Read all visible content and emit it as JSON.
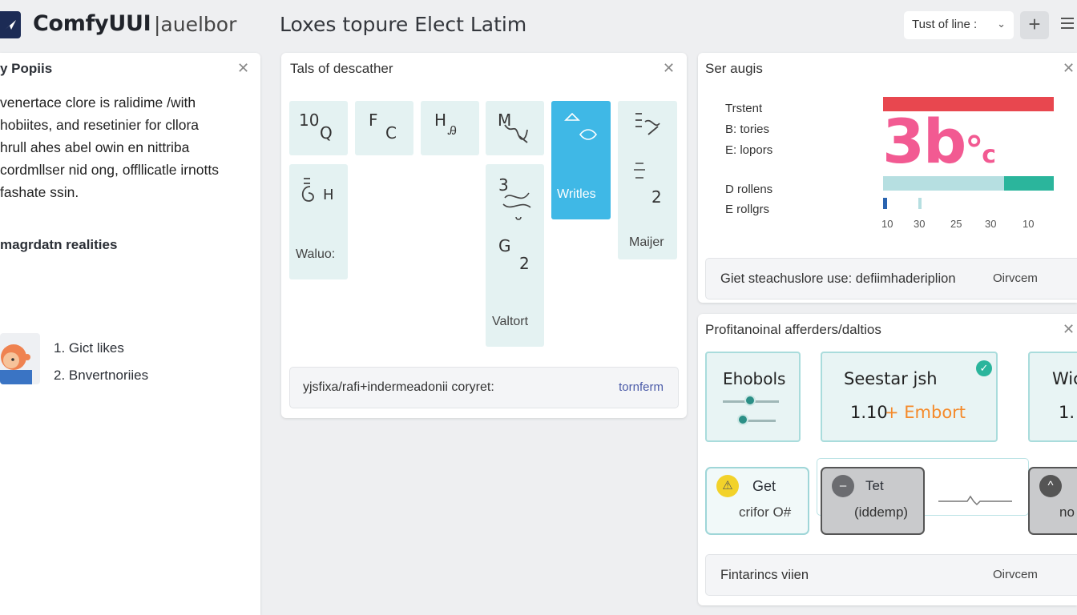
{
  "header": {
    "app_name": "ComfyUUI",
    "app_suffix": "|auelbor",
    "document_title": "Loxes topure Elect Latim",
    "dropdown_value": "Tust of line :",
    "add_symbol": "+"
  },
  "left_panel": {
    "title": "y Popiis",
    "paragraph": "venertace clore is ralidime /with\nhobiites, and resetinier for cllora\nhrull ahes abel owin en nittriba\ncordmllser nid ong, offllicatle irnotts\n fashate ssin.",
    "subheading": "magrdatn realities",
    "list": [
      "1. Gict likes",
      "2. Bnvertnoriies"
    ]
  },
  "middle_panel": {
    "title": "Tals of descather",
    "tiles": {
      "t1": "10",
      "t1b": "Q",
      "t2": "F",
      "t2b": "C",
      "t3": "H",
      "t3b": "Ꭿ",
      "t4": "M",
      "t7": "H",
      "t7_label": "Waluo:",
      "t8a": "3",
      "t8b": "G",
      "t8c": "2",
      "t8_label": "Valtort",
      "active_label": "Writles",
      "t10b": "2",
      "t10_label": "Maijer"
    },
    "footer_text": "yjsfixa/rafi+indermeadonii coryret:",
    "footer_link": "tornferm"
  },
  "stats_panel": {
    "title": "Ser augis",
    "legend_top": [
      "Trstent",
      "B: tories",
      "E: lopors"
    ],
    "legend_bottom": [
      "D rollens",
      "E rollgrs"
    ],
    "score_main": "3b",
    "score_small": "°",
    "score_xs": "c",
    "axis_labels": [
      "10",
      "30",
      "25",
      "30",
      "10"
    ],
    "footer_text": "Giet steachuslore use: defiimhaderiplion",
    "footer_link": "Oirvcem",
    "colors": {
      "red": "#e8474f",
      "pink": "#f25a92",
      "teal": "#2bb59c",
      "light_teal": "#b6dfe1",
      "blue": "#2a64b0"
    }
  },
  "prof_panel": {
    "title": "Profitanoinal afferders/daltios",
    "cards": {
      "card1": "Ehobols",
      "card2_title": "Seestar jsh",
      "card2_value": "1.10",
      "card2_extra": "+ Embort",
      "card3_title": "Wic",
      "card3_value": "1."
    },
    "boxes": {
      "box1_title": "Get",
      "box1_sub": "crifor O#",
      "box2_title": "Tet",
      "box2_sub": "(iddemp)",
      "box3_sub": "no"
    },
    "footer_text": "Fintarincs viien",
    "footer_link": "Oirvcem"
  }
}
